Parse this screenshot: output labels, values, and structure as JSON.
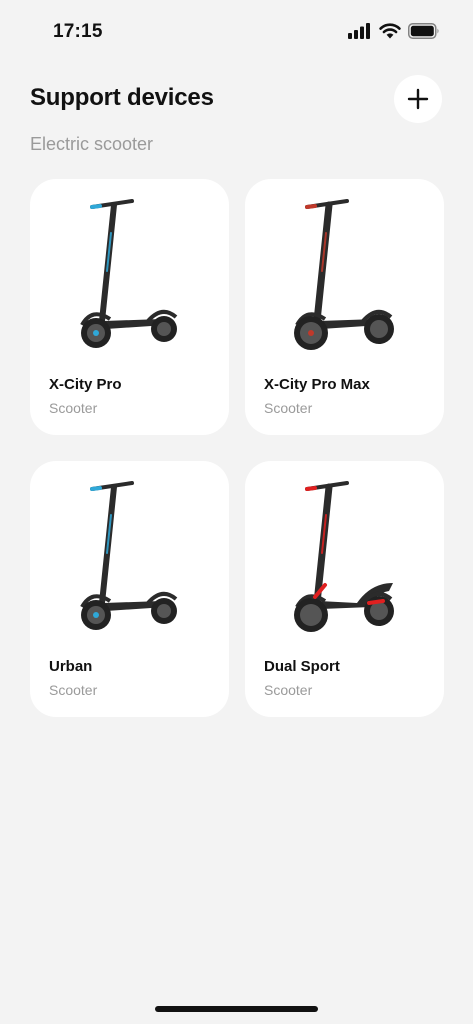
{
  "status_bar": {
    "time": "17:15",
    "signal_icon": "cellular-signal-icon",
    "wifi_icon": "wifi-icon",
    "battery_icon": "battery-icon"
  },
  "header": {
    "title": "Support devices",
    "add_icon": "plus-icon"
  },
  "section": {
    "label": "Electric scooter"
  },
  "devices": [
    {
      "name": "X-City Pro",
      "type": "Scooter",
      "accent": "#2fa8d8",
      "image_icon": "scooter-image"
    },
    {
      "name": "X-City Pro Max",
      "type": "Scooter",
      "accent": "#c0392b",
      "image_icon": "scooter-image"
    },
    {
      "name": "Urban",
      "type": "Scooter",
      "accent": "#2fa8d8",
      "image_icon": "scooter-image"
    },
    {
      "name": "Dual Sport",
      "type": "Scooter",
      "accent": "#e02020",
      "image_icon": "scooter-image"
    }
  ]
}
